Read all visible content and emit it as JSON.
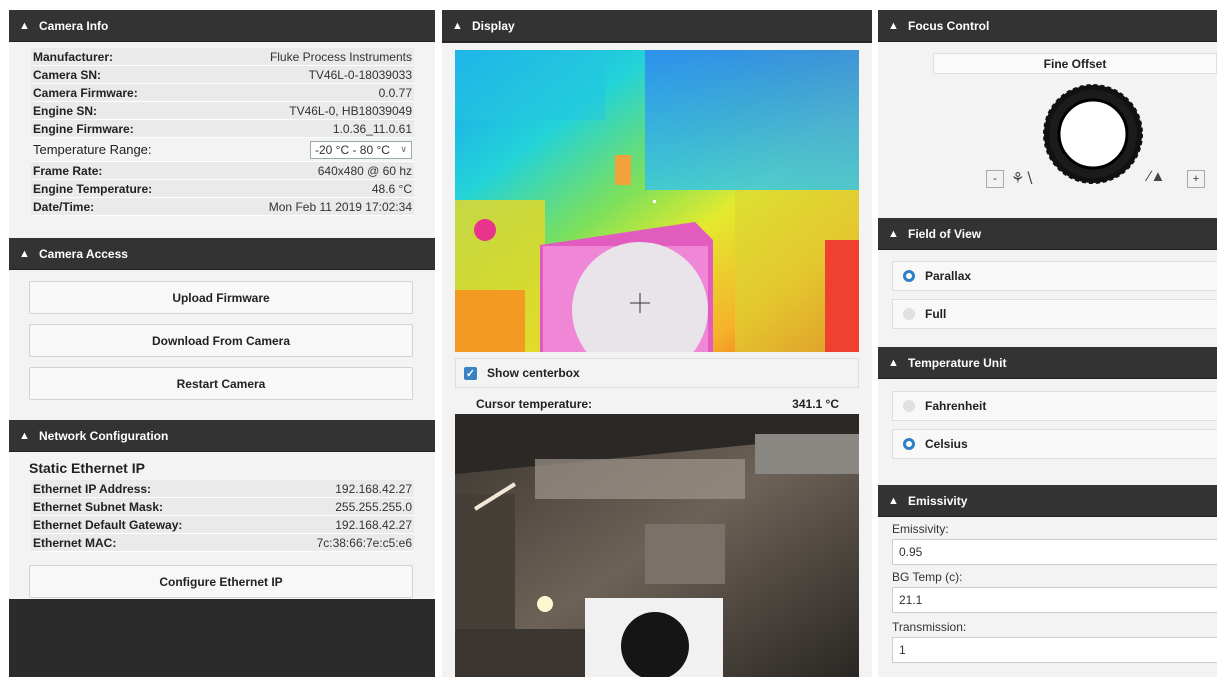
{
  "camera_info": {
    "title": "Camera Info",
    "rows": [
      {
        "label": "Manufacturer:",
        "value": "Fluke Process Instruments"
      },
      {
        "label": "Camera SN:",
        "value": "TV46L-0-18039033"
      },
      {
        "label": "Camera Firmware:",
        "value": "0.0.77"
      },
      {
        "label": "Engine SN:",
        "value": "TV46L-0, HB18039049"
      },
      {
        "label": "Engine Firmware:",
        "value": "1.0.36_11.0.61"
      }
    ],
    "temperature_range_label": "Temperature Range:",
    "temperature_range_value": "-20 °C - 80 °C",
    "rows2": [
      {
        "label": "Frame Rate:",
        "value": "640x480 @ 60 hz"
      },
      {
        "label": "Engine Temperature:",
        "value": "48.6 °C"
      },
      {
        "label": "Date/Time:",
        "value": "Mon Feb 11 2019 17:02:34"
      }
    ]
  },
  "camera_access": {
    "title": "Camera Access",
    "buttons": [
      "Upload Firmware",
      "Download From Camera",
      "Restart Camera"
    ]
  },
  "network": {
    "title": "Network Configuration",
    "subtitle": "Static Ethernet IP",
    "rows": [
      {
        "label": "Ethernet IP Address:",
        "value": "192.168.42.27"
      },
      {
        "label": "Ethernet Subnet Mask:",
        "value": "255.255.255.0"
      },
      {
        "label": "Ethernet Default Gateway:",
        "value": "192.168.42.27"
      },
      {
        "label": "Ethernet MAC:",
        "value": "7c:38:66:7e:c5:e6"
      }
    ],
    "button": "Configure Ethernet IP"
  },
  "display": {
    "title": "Display",
    "show_centerbox_label": "Show centerbox",
    "show_centerbox_checked": true,
    "cursor_label": "Cursor temperature:",
    "cursor_value": "341.1 °C"
  },
  "focus": {
    "title": "Focus Control",
    "fine_offset": "Fine Offset",
    "minus": "-",
    "plus": "+"
  },
  "fov": {
    "title": "Field of View",
    "options": [
      {
        "label": "Parallax",
        "selected": true
      },
      {
        "label": "Full",
        "selected": false
      }
    ]
  },
  "temp_unit": {
    "title": "Temperature Unit",
    "options": [
      {
        "label": "Fahrenheit",
        "selected": false
      },
      {
        "label": "Celsius",
        "selected": true
      }
    ]
  },
  "emissivity": {
    "title": "Emissivity",
    "fields": [
      {
        "label": "Emissivity:",
        "value": "0.95"
      },
      {
        "label": "BG Temp (c):",
        "value": "21.1"
      },
      {
        "label": "Transmission:",
        "value": "1"
      }
    ]
  },
  "colors": {
    "header_bg": "#333333",
    "accent": "#2f7fc6",
    "panel_bg": "#f3f3f3"
  },
  "icons": [
    "chevron-up-icon",
    "crosshair-icon",
    "focus-ring-icon",
    "flower-icon",
    "mountain-icon",
    "checkbox-icon",
    "radio-icon"
  ]
}
